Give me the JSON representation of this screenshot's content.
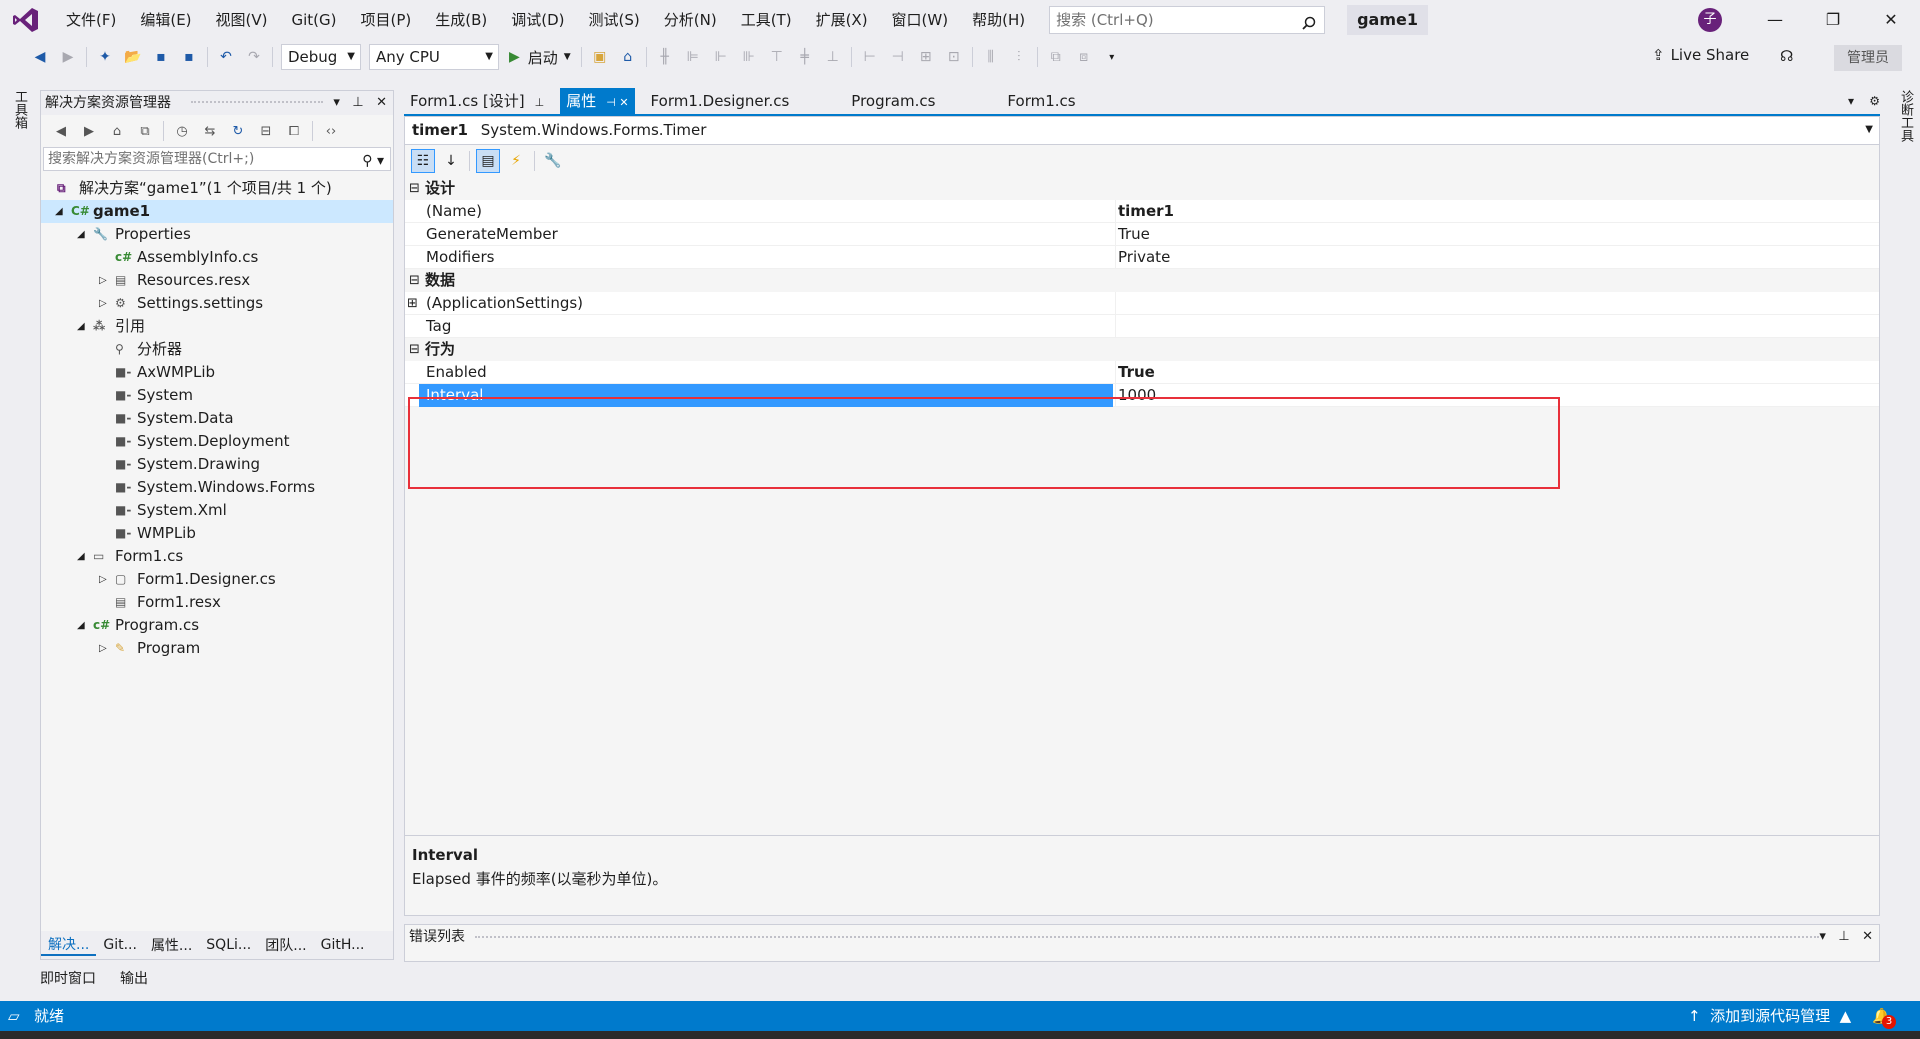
{
  "menu": {
    "items": [
      "文件(F)",
      "编辑(E)",
      "视图(V)",
      "Git(G)",
      "项目(P)",
      "生成(B)",
      "调试(D)",
      "测试(S)",
      "分析(N)",
      "工具(T)",
      "扩展(X)",
      "窗口(W)",
      "帮助(H)"
    ],
    "search_placeholder": "搜索 (Ctrl+Q)",
    "project_name": "game1",
    "avatar_letter": "子"
  },
  "toolbar": {
    "config": "Debug",
    "platform": "Any CPU",
    "start_label": "启动",
    "live_share": "Live Share",
    "admin_label": "管理员"
  },
  "side_strips": {
    "left": "工具箱",
    "right": "诊断工具"
  },
  "solution_explorer": {
    "title": "解决方案资源管理器",
    "search_placeholder": "搜索解决方案资源管理器(Ctrl+;)",
    "tree": [
      {
        "label": "解决方案“game1”(1 个项目/共 1 个)",
        "level": 0,
        "expander": "",
        "icon": "solution-icon",
        "bold": false
      },
      {
        "label": "game1",
        "level": 0,
        "expander": "▲",
        "icon": "csharp-project-icon",
        "bold": true,
        "selected": true
      },
      {
        "label": "Properties",
        "level": 1,
        "expander": "▲",
        "icon": "wrench-icon"
      },
      {
        "label": "AssemblyInfo.cs",
        "level": 2,
        "expander": "",
        "icon": "csharp-file-icon"
      },
      {
        "label": "Resources.resx",
        "level": 2,
        "expander": "▷",
        "icon": "resx-icon"
      },
      {
        "label": "Settings.settings",
        "level": 2,
        "expander": "▷",
        "icon": "gear-icon"
      },
      {
        "label": "引用",
        "level": 1,
        "expander": "▲",
        "icon": "references-icon"
      },
      {
        "label": "分析器",
        "level": 2,
        "expander": "",
        "icon": "analyzer-icon"
      },
      {
        "label": "AxWMPLib",
        "level": 2,
        "expander": "",
        "icon": "assembly-icon"
      },
      {
        "label": "System",
        "level": 2,
        "expander": "",
        "icon": "assembly-icon"
      },
      {
        "label": "System.Data",
        "level": 2,
        "expander": "",
        "icon": "assembly-icon"
      },
      {
        "label": "System.Deployment",
        "level": 2,
        "expander": "",
        "icon": "assembly-icon"
      },
      {
        "label": "System.Drawing",
        "level": 2,
        "expander": "",
        "icon": "assembly-icon"
      },
      {
        "label": "System.Windows.Forms",
        "level": 2,
        "expander": "",
        "icon": "assembly-icon"
      },
      {
        "label": "System.Xml",
        "level": 2,
        "expander": "",
        "icon": "assembly-icon"
      },
      {
        "label": "WMPLib",
        "level": 2,
        "expander": "",
        "icon": "assembly-icon"
      },
      {
        "label": "Form1.cs",
        "level": 1,
        "expander": "▲",
        "icon": "form-icon"
      },
      {
        "label": "Form1.Designer.cs",
        "level": 2,
        "expander": "▷",
        "icon": "designer-file-icon"
      },
      {
        "label": "Form1.resx",
        "level": 2,
        "expander": "",
        "icon": "resx-icon"
      },
      {
        "label": "Program.cs",
        "level": 1,
        "expander": "▲",
        "icon": "csharp-file-icon"
      },
      {
        "label": "Program",
        "level": 2,
        "expander": "▷",
        "icon": "class-icon"
      }
    ],
    "bottom_tabs": [
      "解决...",
      "Git...",
      "属性...",
      "SQLi...",
      "团队...",
      "GitH..."
    ]
  },
  "bottom_panels": [
    "即时窗口",
    "输出"
  ],
  "doc_tabs": [
    {
      "label": "Form1.cs [设计]",
      "pin": "⊥",
      "active": false
    },
    {
      "label": "属性",
      "pin": "⊣ ✕",
      "active": true
    },
    {
      "label": "Form1.Designer.cs",
      "pin": "",
      "active": false
    },
    {
      "label": "Program.cs",
      "pin": "",
      "active": false
    },
    {
      "label": "Form1.cs",
      "pin": "",
      "active": false
    }
  ],
  "properties": {
    "object_name": "timer1",
    "object_type": "System.Windows.Forms.Timer",
    "categories": [
      {
        "name": "设计",
        "rows": [
          {
            "name": "(Name)",
            "value": "timer1",
            "bold": true
          },
          {
            "name": "GenerateMember",
            "value": "True",
            "bold": false
          },
          {
            "name": "Modifiers",
            "value": "Private",
            "bold": false
          }
        ]
      },
      {
        "name": "数据",
        "rows": [
          {
            "name": "(ApplicationSettings)",
            "value": "",
            "bold": false,
            "expandable": true
          },
          {
            "name": "Tag",
            "value": "",
            "bold": false
          }
        ]
      },
      {
        "name": "行为",
        "rows": [
          {
            "name": "Enabled",
            "value": "True",
            "bold": true
          },
          {
            "name": "Interval",
            "value": "1000",
            "bold": false,
            "selected": true
          }
        ]
      }
    ],
    "description_title": "Interval",
    "description_text": "Elapsed 事件的频率(以毫秒为单位)。"
  },
  "error_list": {
    "title": "错误列表"
  },
  "status": {
    "ready": "就绪",
    "source_control": "添加到源代码管理",
    "notification_count": "3"
  },
  "colors": {
    "accent": "#007acc",
    "selection": "#3399ff",
    "highlight_box": "#e8303a"
  }
}
